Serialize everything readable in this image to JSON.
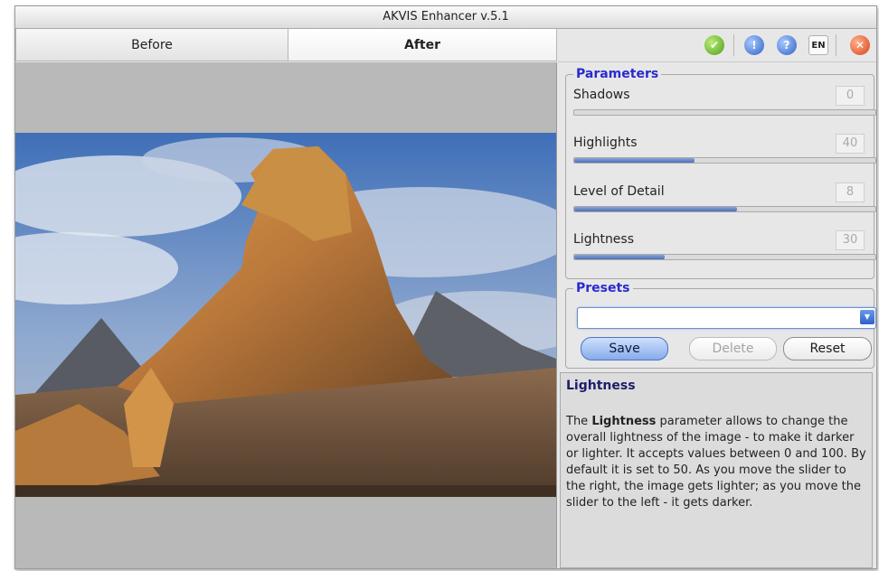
{
  "window": {
    "title": "AKVIS Enhancer v.5.1"
  },
  "tabs": [
    {
      "label": "Before",
      "active": false
    },
    {
      "label": "After",
      "active": true
    }
  ],
  "toolbar": {
    "buttons": [
      {
        "icon": "run-check-icon",
        "color": "#6bbf2a"
      },
      {
        "icon": "info-icon",
        "color": "#3f7fe0"
      },
      {
        "icon": "help-icon",
        "color": "#3f7fe0"
      },
      {
        "icon": "language-icon",
        "label": "EN"
      },
      {
        "icon": "close-icon",
        "color": "#e8502c"
      }
    ]
  },
  "parameters": {
    "legend": "Parameters",
    "sliders": [
      {
        "label": "Shadows",
        "value": "0",
        "level_percent": 0
      },
      {
        "label": "Highlights",
        "value": "40",
        "level_percent": 40
      },
      {
        "label": "Level of Detail",
        "value": "8",
        "level_percent": 54
      },
      {
        "label": "Lightness",
        "value": "30",
        "level_percent": 30
      }
    ]
  },
  "presets": {
    "legend": "Presets",
    "selected": "",
    "save_label": "Save",
    "delete_label": "Delete",
    "reset_label": "Reset"
  },
  "help": {
    "title": "Lightness",
    "text_bold": "Lightness",
    "text_before": "The ",
    "text_after": " parameter allows to change the overall lightness of the image - to make it darker or lighter. It accepts values between 0 and 100. By default it is set to 50. As you move the slider to the right, the image gets lighter; as you move the slider to the left - it gets darker."
  },
  "colors": {
    "legend": "#2a2ad0",
    "slider_fill": "#4d6fb8",
    "accent": "#4a74c3"
  }
}
